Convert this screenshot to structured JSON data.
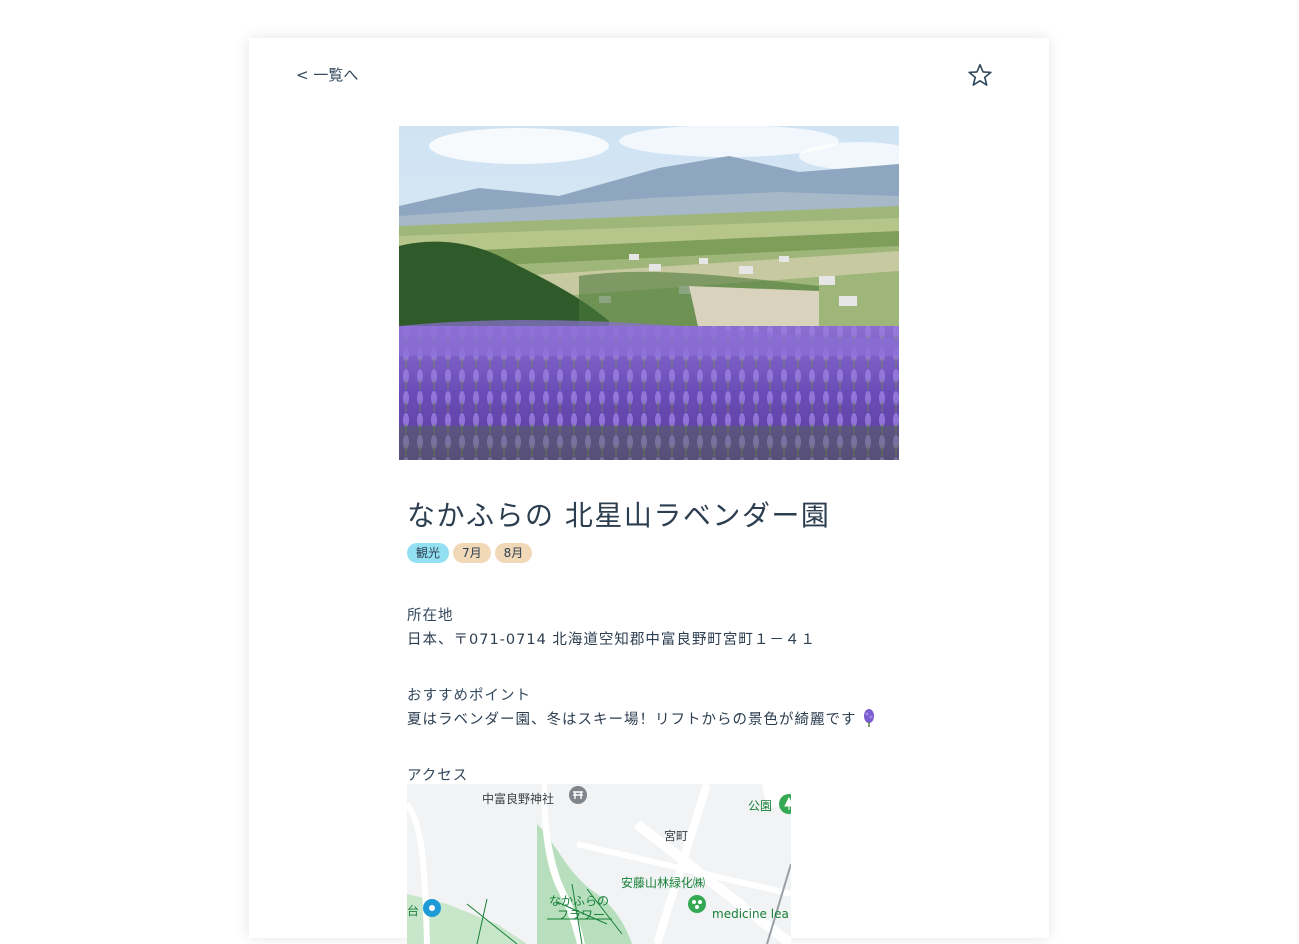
{
  "nav": {
    "back_label": "< 一覧へ",
    "favorite_icon": "star-outline-icon"
  },
  "hero": {
    "image_description_icon": "photo-lavender-field"
  },
  "spot": {
    "title": "なかふらの 北星山ラベンダー園",
    "tags": [
      {
        "label": "観光",
        "color": "#92e0f2"
      },
      {
        "label": "7月",
        "color": "#f1d8b6"
      },
      {
        "label": "8月",
        "color": "#f1d8b6"
      }
    ]
  },
  "sections": {
    "address_label": "所在地",
    "address_value": "日本、〒071-0714 北海道空知郡中富良野町宮町１－４１",
    "point_label": "おすすめポイント",
    "point_value": "夏はラベンダー園、冬はスキー場！リフトからの景色が綺麗です",
    "access_label": "アクセス"
  },
  "map": {
    "labels": {
      "shrine": "中富良野神社",
      "park": "公園",
      "town": "宮町",
      "company": "安藤山林緑化㈱",
      "flower1": "なかふらの",
      "flower2": "フラワー",
      "left_edge": "台",
      "medicine": "medicine lea"
    }
  },
  "colors": {
    "text": "#34495e",
    "tag_category": "#92e0f2",
    "tag_month": "#f1d8b6"
  }
}
